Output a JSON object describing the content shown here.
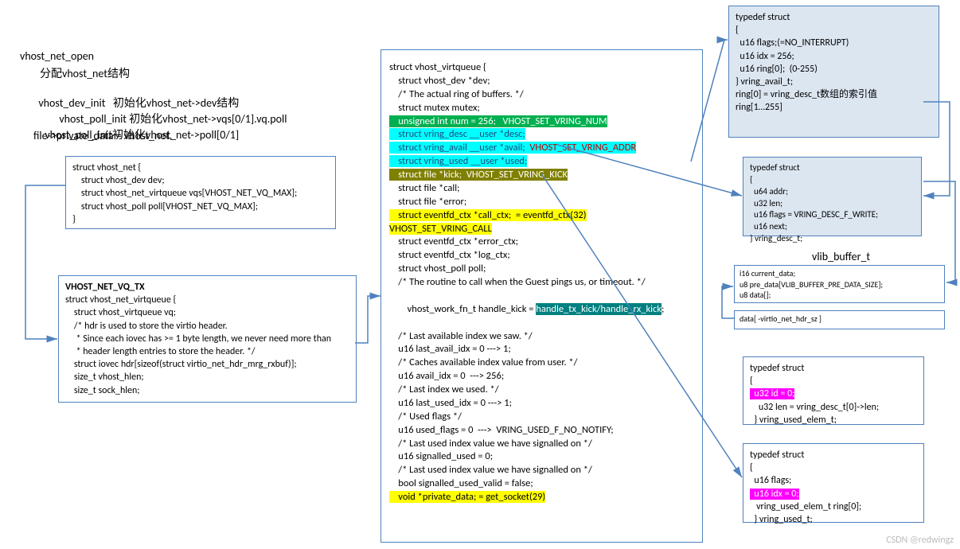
{
  "header": {
    "l1": "vhost_net_open",
    "l2": "分配vhost_net结构",
    "l3_a": "vhost_dev_init   ",
    "l3_b": "初始化",
    "l3_c": "vhost_net->dev结构",
    "l4_a": "vhost_poll_init ",
    "l4_b": "初始化",
    "l4_c": "vhost_net->vqs[0/1].vq.poll",
    "l5_a": "vhost_poll_init",
    "l5_b": "初始化",
    "l5_c": "vhost_net->poll[0/1]",
    "l6": "file->private_data = vhost_net."
  },
  "vhost_net_struct": {
    "lines": [
      "struct vhost_net {",
      "    struct vhost_dev dev;",
      "    struct vhost_net_virtqueue vqs[VHOST_NET_VQ_MAX];",
      "    struct vhost_poll poll[VHOST_NET_VQ_MAX];",
      "}"
    ]
  },
  "vhost_net_vq": {
    "title": "VHOST_NET_VQ_TX",
    "lines": [
      "struct vhost_net_virtqueue {",
      "    struct vhost_virtqueue vq;",
      "    /* hdr is used to store the virtio header.",
      "     * Since each iovec has >= 1 byte length, we never need more than",
      "     * header length entries to store the header. */",
      "    struct iovec hdr[sizeof(struct virtio_net_hdr_mrg_rxbuf)];",
      "    size_t vhost_hlen;",
      "    size_t sock_hlen;"
    ]
  },
  "center": {
    "seg1": [
      "struct vhost_virtqueue {",
      "    struct vhost_dev *dev;",
      "",
      "    /* The actual ring of buffers. */",
      "    struct mutex mutex;"
    ],
    "green": "    unsigned int num = 256;   VHOST_SET_VRING_NUM",
    "cyan1": "    struct vring_desc __user *desc;",
    "cyan2a": "    struct vring_avail __user *avail;  ",
    "cyan2b": "VHOST_SET_VRING_ADDR",
    "cyan3": "    struct vring_used __user *used;",
    "olive": "    struct file *kick;  VHOST_SET_VRING_KICK",
    "seg2": [
      "    struct file *call;",
      "    struct file *error;"
    ],
    "yellow1": "    struct eventfd_ctx *call_ctx;  = eventfd_ctx(32)",
    "yellow1b": "VHOST_SET_VRING_CALL",
    "seg3": [
      "    struct eventfd_ctx *error_ctx;",
      "    struct eventfd_ctx *log_ctx;",
      "",
      "    struct vhost_poll poll;",
      "",
      "    /* The routine to call when the Guest pings us, or timeout. */"
    ],
    "teal_pre": "    vhost_work_fn_t handle_kick = ",
    "teal": "handle_tx_kick/handle_rx_kick",
    "teal_post": ";",
    "seg4": [
      "",
      "    /* Last available index we saw. */",
      "    u16 last_avail_idx = 0 ---> 1;",
      "",
      "    /* Caches available index value from user. */",
      "    u16 avail_idx = 0  ---> 256;",
      "",
      "    /* Last index we used. */",
      "    u16 last_used_idx = 0 ---> 1;",
      "    /* Used flags */",
      "    u16 used_flags = 0  --->  VRING_USED_F_NO_NOTIFY;",
      "",
      "    /* Last used index value we have signalled on */",
      "    u16 signalled_used = 0;",
      "",
      "    /* Last used index value we have signalled on */",
      "    bool signalled_used_valid = false;"
    ],
    "yellow2": "    void *private_data; = get_socket(29)"
  },
  "vring_avail": {
    "lines": [
      "typedef struct",
      "{",
      "  u16 flags;(=NO_INTERRUPT)",
      "  u16 idx = 256;",
      "  u16 ring[0];  (0-255)",
      "} vring_avail_t;",
      "",
      "ring[0] = vring_desc_t数组的索引值",
      "",
      "ring[1…255]"
    ]
  },
  "vring_desc": {
    "lines": [
      "typedef struct",
      "{",
      "  u64 addr;",
      "  u32 len;",
      "  u16 flags = VRING_DESC_F_WRITE;",
      "  u16 next;",
      "} vring_desc_t;"
    ]
  },
  "vlib_buffer": {
    "title": "vlib_buffer_t",
    "top": [
      "i16 current_data;",
      "u8 pre_data[VLIB_BUFFER_PRE_DATA_SIZE];",
      "u8 data[];"
    ],
    "bottom": "data[ -virtio_net_hdr_sz ]"
  },
  "used_elem": {
    "lines_pre": [
      "typedef struct",
      "{"
    ],
    "magenta": "  u32 id = 0;",
    "lines_post": [
      "    u32 len = vring_desc_t[0]->len;",
      "  } vring_used_elem_t;"
    ]
  },
  "vring_used": {
    "lines_pre": [
      "typedef struct",
      "{",
      "  u16 flags;"
    ],
    "magenta": "  u16 idx = 0;",
    "lines_post": [
      "   vring_used_elem_t ring[0];",
      "  } vring_used_t;"
    ]
  },
  "watermark": "CSDN @redwingz"
}
